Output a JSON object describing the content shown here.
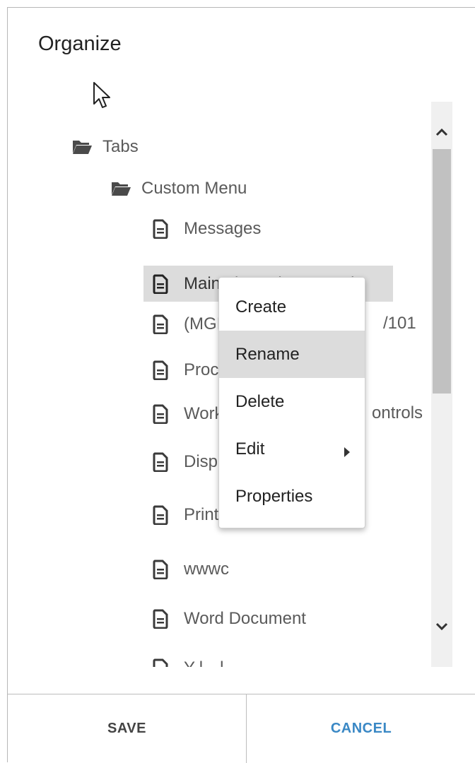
{
  "dialog": {
    "title": "Organize"
  },
  "tree": {
    "items": [
      {
        "label": "Tabs",
        "icon": "folder-open-icon",
        "level": 0
      },
      {
        "label": "Custom Menu",
        "icon": "folder-open-icon",
        "level": 1
      },
      {
        "label": "Messages",
        "icon": "document-icon",
        "level": 2
      },
      {
        "label": "Maintain Entity Controls",
        "icon": "document-icon",
        "level": 2,
        "selected": true
      },
      {
        "label": "(MGI",
        "suffix": "/101",
        "icon": "document-icon",
        "level": 2
      },
      {
        "label": "Proc",
        "icon": "document-icon",
        "level": 2
      },
      {
        "label": "Work",
        "suffix": "ontrols",
        "icon": "document-icon",
        "level": 2
      },
      {
        "label": "Displ",
        "icon": "document-icon",
        "level": 2
      },
      {
        "label": "Print",
        "icon": "document-icon",
        "level": 2
      },
      {
        "label": "wwwc",
        "icon": "document-icon",
        "level": 2
      },
      {
        "label": "Word Document",
        "icon": "document-icon",
        "level": 2
      },
      {
        "label": "Y-l---l-",
        "icon": "document-icon",
        "level": 2
      }
    ]
  },
  "context_menu": {
    "items": [
      {
        "label": "Create"
      },
      {
        "label": "Rename",
        "active": true
      },
      {
        "label": "Delete"
      },
      {
        "label": "Edit",
        "has_submenu": true
      },
      {
        "label": "Properties"
      }
    ]
  },
  "footer": {
    "save_label": "SAVE",
    "cancel_label": "CANCEL"
  },
  "colors": {
    "accent": "#3a88c5",
    "selection": "#dcdcdc",
    "scroll_thumb": "#c1c1c1"
  }
}
